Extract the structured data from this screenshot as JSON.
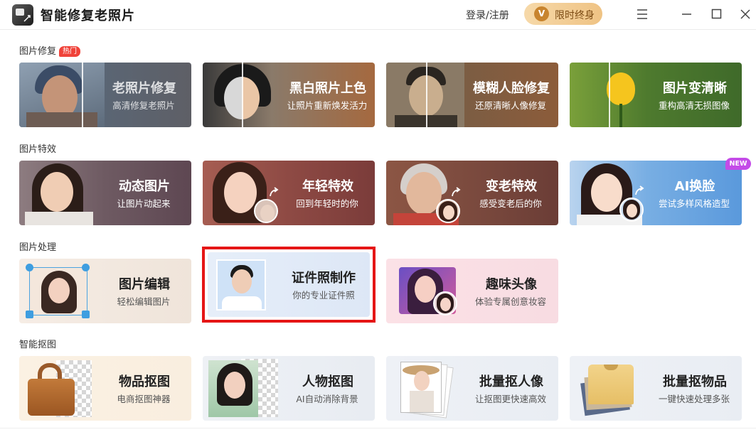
{
  "app": {
    "title": "智能修复老照片"
  },
  "header": {
    "login_label": "登录/注册",
    "vip_label": "限时终身",
    "vip_badge": "V"
  },
  "sections": [
    {
      "title": "图片修复",
      "badge": "热门"
    },
    {
      "title": "图片特效"
    },
    {
      "title": "图片处理"
    },
    {
      "title": "智能抠图"
    }
  ],
  "cards": {
    "old_photo": {
      "title": "老照片修复",
      "sub": "高清修复老照片"
    },
    "colorize": {
      "title": "黑白照片上色",
      "sub": "让照片重新焕发活力"
    },
    "face_repair": {
      "title": "模糊人脸修复",
      "sub": "还原清晰人像修复"
    },
    "sharpen": {
      "title": "图片变清晰",
      "sub": "重构高清无损图像"
    },
    "animate": {
      "title": "动态图片",
      "sub": "让图片动起来"
    },
    "younger": {
      "title": "年轻特效",
      "sub": "回到年轻时的你"
    },
    "older": {
      "title": "变老特效",
      "sub": "感受变老后的你"
    },
    "face_swap": {
      "title": "AI换脸",
      "sub": "尝试多样风格造型",
      "badge": "NEW"
    },
    "edit": {
      "title": "图片编辑",
      "sub": "轻松编辑图片"
    },
    "id_photo": {
      "title": "证件照制作",
      "sub": "你的专业证件照"
    },
    "avatar": {
      "title": "趣味头像",
      "sub": "体验专属创意妆容"
    },
    "object_cutout": {
      "title": "物品抠图",
      "sub": "电商抠图神器"
    },
    "person_cutout": {
      "title": "人物抠图",
      "sub": "AI自动消除背景"
    },
    "batch_person": {
      "title": "批量抠人像",
      "sub": "让抠图更快速高效"
    },
    "batch_object": {
      "title": "批量抠物品",
      "sub": "一键快速处理多张"
    }
  },
  "colors": {
    "highlight_frame": "#e51616",
    "hot_badge": "#f0433a",
    "new_badge": "#c44be8",
    "vip_gradient_start": "#f6d9a9",
    "vip_gradient_end": "#efc384"
  }
}
